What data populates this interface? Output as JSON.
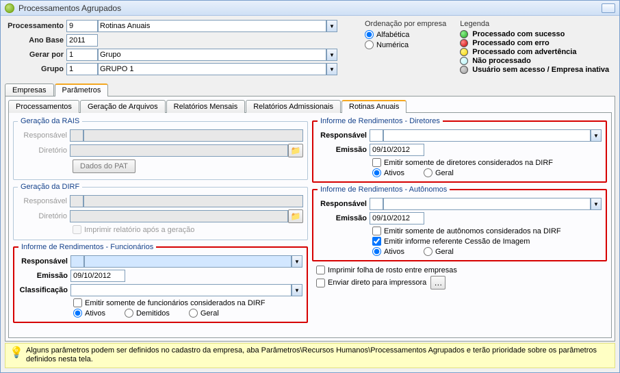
{
  "window_title": "Processamentos Agrupados",
  "header": {
    "processamento_label": "Processamento",
    "processamento_num": "9",
    "processamento_desc": "Rotinas Anuais",
    "ano_base_label": "Ano Base",
    "ano_base": "2011",
    "gerar_por_label": "Gerar por",
    "gerar_por_num": "1",
    "gerar_por_desc": "Grupo",
    "grupo_label": "Grupo",
    "grupo_num": "1",
    "grupo_desc": "GRUPO 1"
  },
  "ordenacao": {
    "title": "Ordenação por empresa",
    "alfabetica": "Alfabética",
    "numerica": "Numérica"
  },
  "legenda": {
    "title": "Legenda",
    "items": [
      {
        "color": "#1fa81f",
        "label": "Processado com sucesso"
      },
      {
        "color": "#cc0000",
        "label": "Processado com erro"
      },
      {
        "color": "#f5d400",
        "label": "Processado com advertência"
      },
      {
        "color": "#b5f0f5",
        "label": "Não processado"
      },
      {
        "color": "#9e9e9e",
        "label": "Usuário sem acesso / Empresa inativa"
      }
    ]
  },
  "main_tabs": [
    "Empresas",
    "Parâmetros"
  ],
  "main_tab_active": 1,
  "sub_tabs": [
    "Processamentos",
    "Geração de Arquivos",
    "Relatórios Mensais",
    "Relatórios Admissionais",
    "Rotinas Anuais"
  ],
  "sub_tab_active": 4,
  "rais": {
    "legend": "Geração da RAIS",
    "responsavel_label": "Responsável",
    "diretorio_label": "Diretório",
    "dados_pat": "Dados do PAT"
  },
  "dirf": {
    "legend": "Geração da DIRF",
    "responsavel_label": "Responsável",
    "diretorio_label": "Diretório",
    "imprimir_relatorio": "Imprimir relatório após a geração"
  },
  "funcionarios": {
    "legend": "Informe de Rendimentos - Funcionários",
    "responsavel_label": "Responsável",
    "emissao_label": "Emissão",
    "emissao": "09/10/2012",
    "class_label": "Classificação",
    "cb_dirf": "Emitir somente de funcionários considerados na DIRF",
    "r_ativos": "Ativos",
    "r_demitidos": "Demitidos",
    "r_geral": "Geral"
  },
  "diretores": {
    "legend": "Informe de Rendimentos - Diretores",
    "responsavel_label": "Responsável",
    "emissao_label": "Emissão",
    "emissao": "09/10/2012",
    "cb_dirf": "Emitir somente de diretores considerados na DIRF",
    "r_ativos": "Ativos",
    "r_geral": "Geral"
  },
  "autonomos": {
    "legend": "Informe de Rendimentos - Autônomos",
    "responsavel_label": "Responsável",
    "emissao_label": "Emissão",
    "emissao": "09/10/2012",
    "cb_dirf": "Emitir somente de autônomos considerados na DIRF",
    "cb_cessao": "Emitir informe referente Cessão de Imagem",
    "r_ativos": "Ativos",
    "r_geral": "Geral"
  },
  "extras": {
    "folha_rosto": "Imprimir folha de rosto entre empresas",
    "enviar_impressora": "Enviar direto para impressora"
  },
  "footer_note": "Alguns parâmetros podem ser definidos no cadastro da empresa, aba Parâmetros\\Recursos Humanos\\Processamentos Agrupados e terão prioridade sobre os parâmetros definidos nesta tela."
}
